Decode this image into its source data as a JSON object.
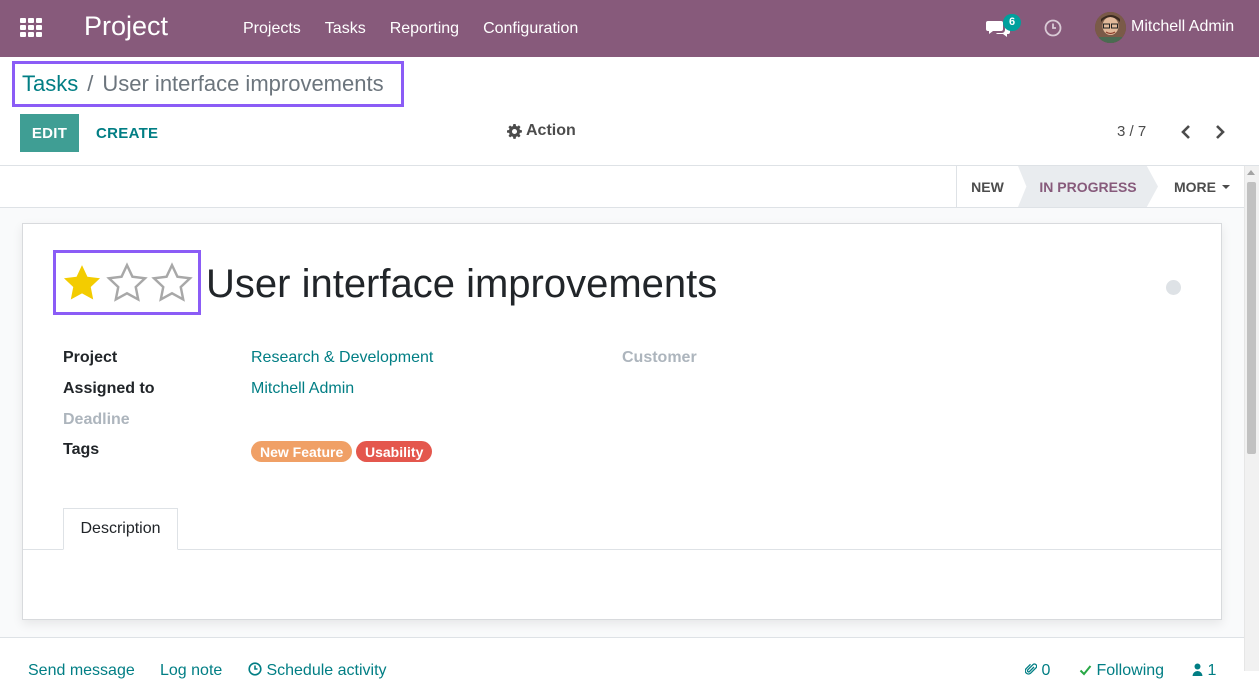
{
  "navbar": {
    "app_name": "Project",
    "menu": [
      "Projects",
      "Tasks",
      "Reporting",
      "Configuration"
    ],
    "chat_count": "6",
    "user_name": "Mitchell Admin",
    "bg_color": "#875a7b"
  },
  "breadcrumb": {
    "parent": "Tasks",
    "separator": "/",
    "current": "User interface improvements"
  },
  "toolbar": {
    "edit_label": "EDIT",
    "create_label": "CREATE",
    "action_label": "Action",
    "pager": "3 / 7"
  },
  "statusbar": {
    "stages": [
      "NEW",
      "IN PROGRESS"
    ],
    "active_stage": "IN PROGRESS",
    "more_label": "MORE"
  },
  "task": {
    "priority": {
      "value": 1,
      "max": 3
    },
    "title": "User interface improvements",
    "fields": {
      "project_label": "Project",
      "project_value": "Research & Development",
      "assigned_label": "Assigned to",
      "assigned_value": "Mitchell Admin",
      "deadline_label": "Deadline",
      "tags_label": "Tags",
      "customer_label": "Customer"
    },
    "tags": [
      {
        "name": "New Feature",
        "color": "#f0a066"
      },
      {
        "name": "Usability",
        "color": "#e4574d"
      }
    ]
  },
  "tabs": {
    "description": "Description"
  },
  "chatter": {
    "send_message": "Send message",
    "log_note": "Log note",
    "schedule_activity": "Schedule activity",
    "attachments": "0",
    "following": "Following",
    "followers": "1"
  },
  "colors": {
    "accent": "#017e84",
    "highlight_box": "#8b5cf6",
    "star_filled": "#f3cc00",
    "star_empty": "#a8a8a8"
  }
}
